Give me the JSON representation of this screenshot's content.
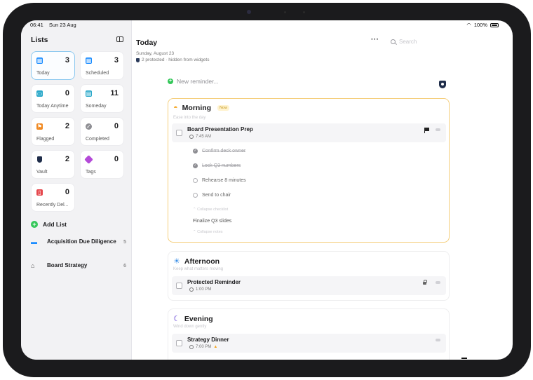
{
  "status_bar": {
    "time": "06:41",
    "date": "Sun 23 Aug",
    "battery": "100%"
  },
  "sidebar": {
    "title": "Lists",
    "smart_lists": [
      {
        "label": "Today",
        "count": "3",
        "icon": "calendar-icon",
        "color": "#1a8cff"
      },
      {
        "label": "Scheduled",
        "count": "3",
        "icon": "calendar-icon",
        "color": "#1a8cff"
      },
      {
        "label": "Today Anytime",
        "count": "0",
        "icon": "tray-icon",
        "color": "#2aa8c9"
      },
      {
        "label": "Someday",
        "count": "11",
        "icon": "archive-icon",
        "color": "#2aa8c9"
      },
      {
        "label": "Flagged",
        "count": "2",
        "icon": "flag-icon",
        "color": "#f08a24"
      },
      {
        "label": "Completed",
        "count": "0",
        "icon": "checkmark-icon",
        "color": "#8e8e93"
      },
      {
        "label": "Vault",
        "count": "2",
        "icon": "shield-icon",
        "color": "#1f2d4a"
      },
      {
        "label": "Tags",
        "count": "0",
        "icon": "tag-icon",
        "color": "#b44ad8"
      },
      {
        "label": "Recently Del...",
        "count": "0",
        "icon": "trash-icon",
        "color": "#e5484d"
      }
    ],
    "add_list_label": "Add List",
    "lists": [
      {
        "name": "Acquisition Due Diligence",
        "count": "5",
        "icon": "briefcase-icon",
        "color": "#1a8cff"
      },
      {
        "name": "Board Strategy",
        "count": "6",
        "icon": "bank-icon",
        "color": "#555555"
      }
    ]
  },
  "main": {
    "title": "Today",
    "more_label": "···",
    "search_placeholder": "Search",
    "date": "Sunday, August 23",
    "protected_note": "2 protected · hidden from widgets",
    "new_reminder_placeholder": "New reminder...",
    "sections": {
      "morning": {
        "name": "Morning",
        "badge": "Now",
        "subtitle": "Ease into the day",
        "task": {
          "title": "Board Presentation Prep",
          "time": "7:45 AM",
          "subtasks": [
            {
              "text": "Confirm deck owner",
              "done": true
            },
            {
              "text": "Lock Q3 numbers",
              "done": true
            },
            {
              "text": "Rehearse 8 minutes",
              "done": false
            },
            {
              "text": "Send to chair",
              "done": false
            }
          ],
          "collapse_checklist": "⌃ Collapse checklist",
          "notes": "Finalize Q3 slides",
          "collapse_notes": "⌃ Collapse notes"
        }
      },
      "afternoon": {
        "name": "Afternoon",
        "subtitle": "Keep what matters moving",
        "task": {
          "title": "Protected Reminder",
          "time": "1:00 PM"
        }
      },
      "evening": {
        "name": "Evening",
        "subtitle": "Wind down gently",
        "task": {
          "title": "Strategy Dinner",
          "time": "7:00 PM"
        }
      }
    }
  }
}
